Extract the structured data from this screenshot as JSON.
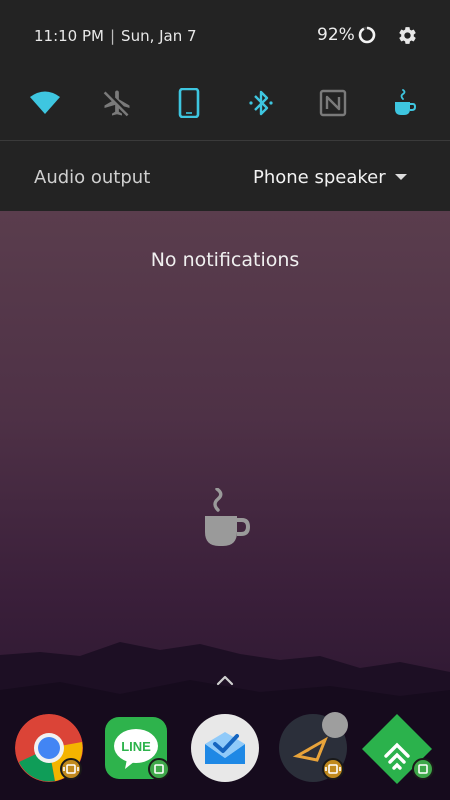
{
  "status": {
    "time": "11:10 PM",
    "separator": "|",
    "date": "Sun, Jan 7",
    "battery_percent": "92%",
    "battery_level": 0.92
  },
  "quick_settings": [
    {
      "name": "wifi-icon",
      "active": true
    },
    {
      "name": "airplane-mode-icon",
      "active": false
    },
    {
      "name": "mobile-data-icon",
      "active": true
    },
    {
      "name": "bluetooth-icon",
      "active": true
    },
    {
      "name": "nfc-icon",
      "active": false
    },
    {
      "name": "caffeine-icon",
      "active": true
    }
  ],
  "audio": {
    "label": "Audio output",
    "value": "Phone speaker"
  },
  "notifications": {
    "empty_text": "No notifications"
  },
  "dock": {
    "apps": [
      "Chrome",
      "LINE",
      "Inbox",
      "Sleep",
      "Feedly"
    ],
    "line_label": "LINE"
  },
  "colors": {
    "accent": "#3ec6e0",
    "inactive": "#7a7a7a",
    "shade_bg": "#232323"
  }
}
